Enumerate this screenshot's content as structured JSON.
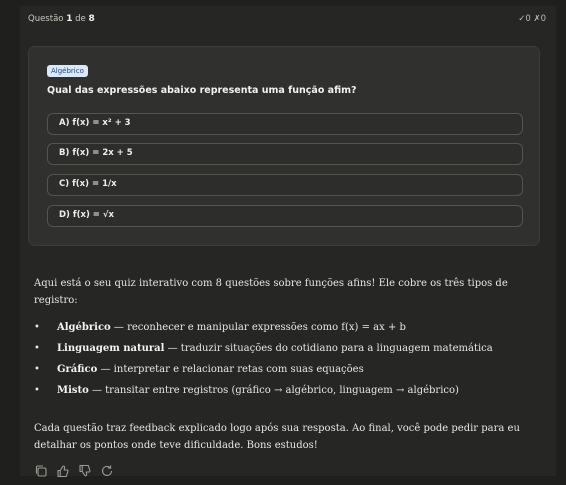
{
  "header": {
    "question_prefix": "Questão",
    "question_number": "1",
    "question_sep": "de",
    "question_total": "8",
    "score": "✓0 ✗0"
  },
  "card": {
    "badge": "Algébrico",
    "question": "Qual das expressões abaixo representa uma função afim?",
    "options": [
      "A) f(x) = x² + 3",
      "B) f(x) = 2x + 5",
      "C) f(x) = 1/x",
      "D) f(x) = √x"
    ]
  },
  "message": {
    "intro": "Aqui está o seu quiz interativo com 8 questões sobre funções afins! Ele cobre os três tipos de registro:",
    "bullets": [
      {
        "term": "Algébrico",
        "desc": " — reconhecer e manipular expressões como f(x) = ax + b"
      },
      {
        "term": "Linguagem natural",
        "desc": " — traduzir situações do cotidiano para a linguagem matemática"
      },
      {
        "term": "Gráfico",
        "desc": " — interpretar e relacionar retas com suas equações"
      },
      {
        "term": "Misto",
        "desc": " — transitar entre registros (gráfico → algébrico, linguagem → algébrico)"
      }
    ],
    "bullet_char": "•",
    "outro": "Cada questão traz feedback explicado logo após sua resposta. Ao final, você pode pedir para eu detalhar os pontos onde teve dificuldade. Bons estudos!"
  },
  "actions": [
    "copy-icon",
    "thumbs-up-icon",
    "thumbs-down-icon",
    "retry-icon"
  ],
  "colors": {
    "background": "#262624",
    "card": "#30302e",
    "badge_bg": "#dbe7fb",
    "badge_text": "#234a8f"
  }
}
